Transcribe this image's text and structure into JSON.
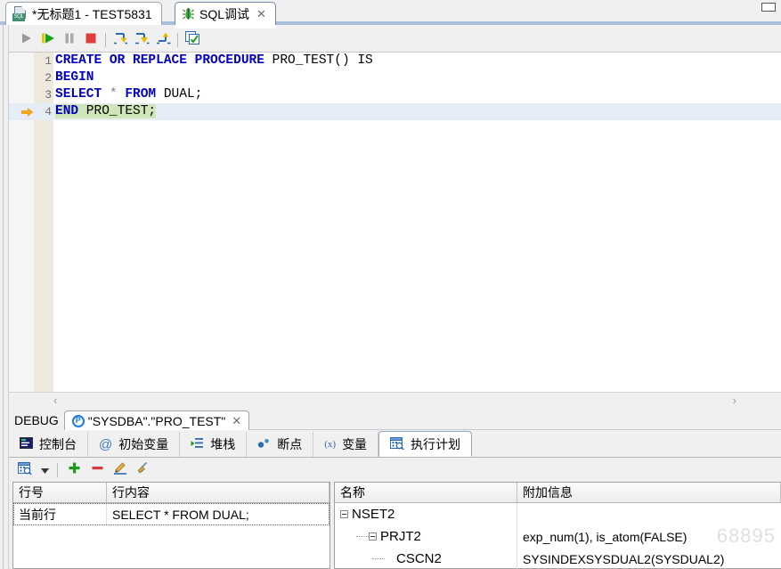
{
  "window": {
    "minimize_label": "—"
  },
  "top_tabs": [
    {
      "label": "*无标题1 - TEST5831",
      "icon": "sql-document-icon",
      "active": false,
      "closable": false
    },
    {
      "label": "SQL调试",
      "icon": "bug-icon",
      "active": true,
      "closable": true,
      "close_label": "✕"
    }
  ],
  "editor_toolbar": {
    "buttons": [
      {
        "name": "run-button",
        "title": "运行",
        "icon": "play-gray-icon"
      },
      {
        "name": "resume-button",
        "title": "继续",
        "icon": "play-green-icon"
      },
      {
        "name": "pause-button",
        "title": "暂停",
        "icon": "pause-icon"
      },
      {
        "name": "stop-button",
        "title": "停止",
        "icon": "stop-red-icon"
      },
      {
        "name": "step-into-button",
        "title": "步入",
        "icon": "step-into-icon"
      },
      {
        "name": "step-over-button",
        "title": "步过",
        "icon": "step-over-icon"
      },
      {
        "name": "step-out-button",
        "title": "步出",
        "icon": "step-out-icon"
      },
      {
        "name": "show-plan-button",
        "title": "执行计划",
        "icon": "plan-window-icon"
      }
    ]
  },
  "code": {
    "lines": [
      {
        "number": "1",
        "current": false,
        "marker": false,
        "tokens": [
          {
            "t": "CREATE OR REPLACE PROCEDURE ",
            "c": "kw"
          },
          {
            "t": "PRO_TEST() IS",
            "c": "plain"
          }
        ]
      },
      {
        "number": "2",
        "current": false,
        "marker": false,
        "tokens": [
          {
            "t": "BEGIN",
            "c": "kw"
          }
        ]
      },
      {
        "number": "3",
        "current": false,
        "marker": false,
        "tokens": [
          {
            "t": "SELECT ",
            "c": "kw"
          },
          {
            "t": "* ",
            "c": "op"
          },
          {
            "t": "FROM ",
            "c": "kw"
          },
          {
            "t": "DUAL;",
            "c": "plain"
          }
        ]
      },
      {
        "number": "4",
        "current": true,
        "marker": true,
        "tokens": [
          {
            "t": "END",
            "c": "kw hl"
          },
          {
            "t": " PRO_TEST;",
            "c": "plain hl"
          }
        ]
      }
    ]
  },
  "editor_scroll": {
    "left_arrow": "‹",
    "right_arrow": "›"
  },
  "debug_bar": {
    "label": "DEBUG",
    "tab": {
      "icon": "breakpoint-p-icon",
      "icon_letter": "P",
      "label": "\"SYSDBA\".\"PRO_TEST\"",
      "close_label": "✕"
    }
  },
  "bottom_tabs": [
    {
      "label": "控制台",
      "icon": "console-icon",
      "active": false
    },
    {
      "label": "初始变量",
      "icon": "at-icon",
      "active": false
    },
    {
      "label": "堆栈",
      "icon": "stack-icon",
      "active": false
    },
    {
      "label": "断点",
      "icon": "breakpoint-dots-icon",
      "active": false
    },
    {
      "label": "变量",
      "icon": "variable-x-icon",
      "active": false
    },
    {
      "label": "执行计划",
      "icon": "plan-icon",
      "active": true
    }
  ],
  "plan_toolbar": {
    "buttons": [
      {
        "name": "plan-select-button",
        "icon": "plan-icon",
        "title": "执行计划"
      },
      {
        "name": "plan-dropdown-button",
        "icon": "chevron-down-icon",
        "title": "▼"
      },
      {
        "name": "add-button",
        "icon": "plus-icon",
        "title": "添加"
      },
      {
        "name": "remove-button",
        "icon": "minus-icon",
        "title": "删除"
      },
      {
        "name": "edit-button",
        "icon": "pencil-icon",
        "title": "编辑"
      },
      {
        "name": "clear-button",
        "icon": "broom-icon",
        "title": "清除"
      }
    ]
  },
  "left_table": {
    "columns": [
      "行号",
      "行内容"
    ],
    "rows": [
      {
        "line_no": "当前行",
        "content": "SELECT * FROM DUAL;"
      }
    ]
  },
  "right_table": {
    "columns": [
      "名称",
      "附加信息"
    ],
    "rows": [
      {
        "depth": 0,
        "expander": true,
        "name": "NSET2",
        "info": ""
      },
      {
        "depth": 1,
        "expander": true,
        "name": "PRJT2",
        "info": "exp_num(1), is_atom(FALSE)"
      },
      {
        "depth": 2,
        "expander": false,
        "name": "CSCN2",
        "info": "SYSINDEXSYSDUAL2(SYSDUAL2)"
      }
    ]
  },
  "watermark": {
    "text": "68895"
  },
  "colors": {
    "keyword": "#0000c0",
    "highlight": "#cfe6b8",
    "current_line": "#e6edf7",
    "accent": "#a8c0dc",
    "marker_arrow": "#f0a820"
  }
}
